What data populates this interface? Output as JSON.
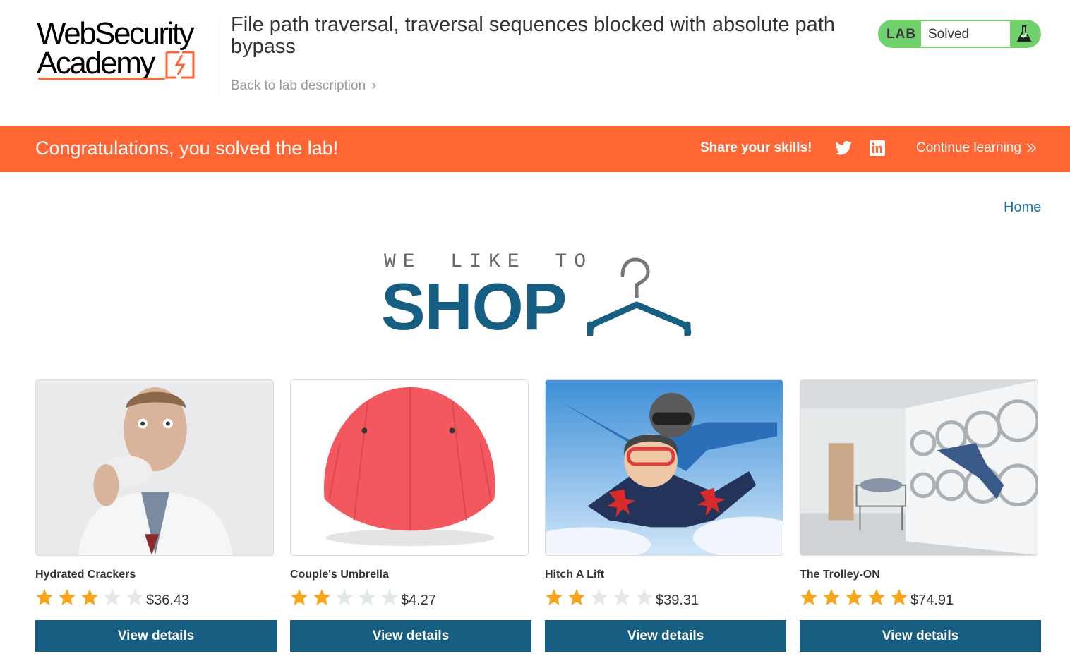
{
  "header": {
    "logo_line1": "WebSecurity",
    "logo_line2": "Academy",
    "lab_title": "File path traversal, traversal sequences blocked with absolute path bypass",
    "back_link": "Back to lab description",
    "lab_badge_label": "LAB",
    "lab_status": "Solved",
    "colors": {
      "badge": "#70d16d",
      "accent": "#ff6633"
    }
  },
  "banner": {
    "message": "Congratulations, you solved the lab!",
    "share_label": "Share your skills!",
    "continue_label": "Continue learning",
    "icons": [
      "twitter-icon",
      "linkedin-icon"
    ]
  },
  "nav": {
    "home": "Home"
  },
  "shop_logo": {
    "tagline": "WE LIKE TO",
    "word": "SHOP"
  },
  "products": [
    {
      "name": "Hydrated Crackers",
      "rating": 3,
      "max_rating": 5,
      "price": "$36.43",
      "button": "View details"
    },
    {
      "name": "Couple's Umbrella",
      "rating": 2,
      "max_rating": 5,
      "price": "$4.27",
      "button": "View details"
    },
    {
      "name": "Hitch A Lift",
      "rating": 2,
      "max_rating": 5,
      "price": "$39.31",
      "button": "View details"
    },
    {
      "name": "The Trolley-ON",
      "rating": 5,
      "max_rating": 5,
      "price": "$74.91",
      "button": "View details"
    }
  ]
}
